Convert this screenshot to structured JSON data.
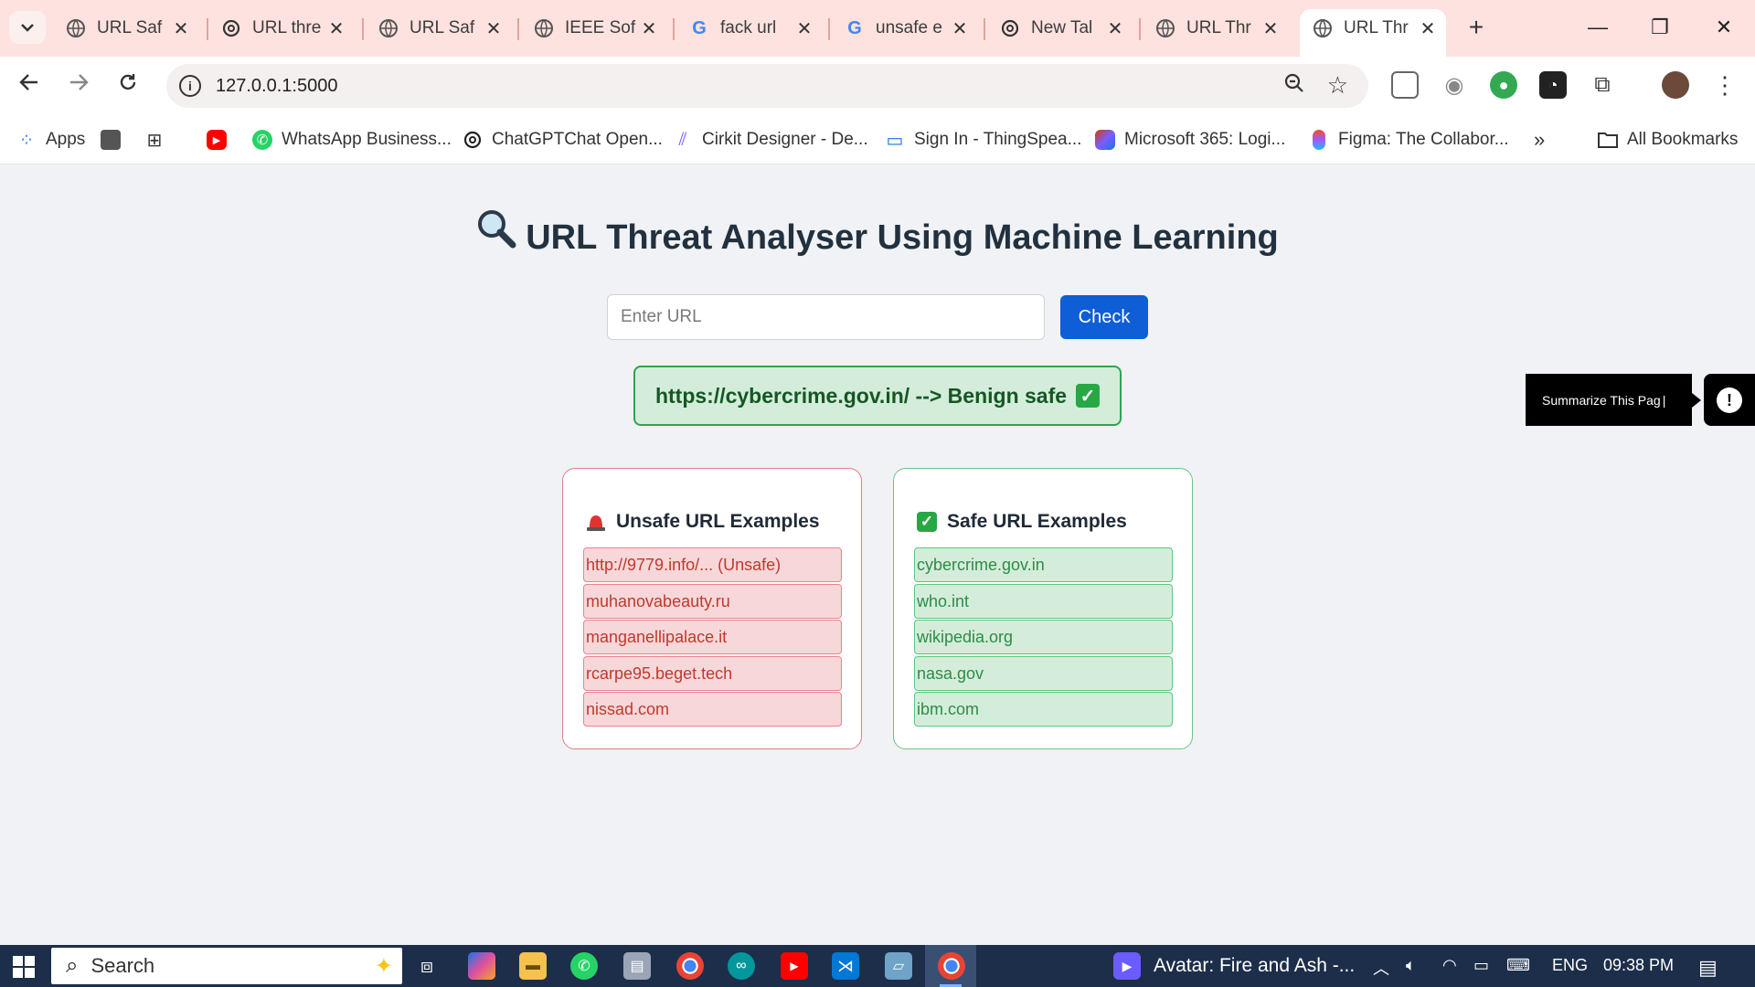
{
  "browser": {
    "tabs": [
      {
        "title": "URL Saf",
        "icon": "globe-icon",
        "active": false
      },
      {
        "title": "URL thre",
        "icon": "chatgpt-icon",
        "active": false
      },
      {
        "title": "URL Saf",
        "icon": "globe-icon",
        "active": false
      },
      {
        "title": "IEEE Sof",
        "icon": "globe-icon",
        "active": false
      },
      {
        "title": "fack url",
        "icon": "google-icon",
        "active": false
      },
      {
        "title": "unsafe e",
        "icon": "google-icon",
        "active": false
      },
      {
        "title": "New Tal",
        "icon": "chatgpt-icon",
        "active": false
      },
      {
        "title": "URL Thr",
        "icon": "globe-icon",
        "active": false
      },
      {
        "title": "URL Thr",
        "icon": "globe-icon",
        "active": true
      }
    ],
    "address": "127.0.0.1:5000",
    "bookmarks": [
      {
        "label": "Apps",
        "icon": "apps-grid-icon",
        "color": "#4285f4"
      },
      {
        "label": "",
        "icon": "square-icon",
        "color": "#555555"
      },
      {
        "label": "",
        "icon": "grid-icon",
        "color": "#333333"
      },
      {
        "label": "",
        "icon": "youtube-icon",
        "color": "#ff0000"
      },
      {
        "label": "WhatsApp Business...",
        "icon": "whatsapp-icon",
        "color": "#25d366"
      },
      {
        "label": "ChatGPTChat Open...",
        "icon": "chatgpt-icon",
        "color": "#222222"
      },
      {
        "label": "Cirkit Designer - De...",
        "icon": "cirkit-icon",
        "color": "#7b5cff"
      },
      {
        "label": "Sign In - ThingSpea...",
        "icon": "monitor-icon",
        "color": "#1a73e8"
      },
      {
        "label": "Microsoft 365: Logi...",
        "icon": "m365-icon",
        "color": "#d83b01"
      },
      {
        "label": "Figma: The Collabor...",
        "icon": "figma-icon",
        "color": "#f24e1e"
      }
    ],
    "all_bookmarks": "All Bookmarks"
  },
  "page": {
    "title": "URL Threat Analyser Using Machine Learning",
    "input_placeholder": "Enter URL",
    "check_label": "Check",
    "result_text": "https://cybercrime.gov.in/ --> Benign safe",
    "result_color": "#155724",
    "unsafe": {
      "heading": "Unsafe URL Examples",
      "items": [
        "http://9779.info/... (Unsafe)",
        "muhanovabeauty.ru",
        "manganellipalace.it",
        "rcarpe95.beget.tech",
        "nissad.com"
      ]
    },
    "safe": {
      "heading": "Safe URL Examples",
      "items": [
        "cybercrime.gov.in",
        "who.int",
        "wikipedia.org",
        "nasa.gov",
        "ibm.com"
      ]
    },
    "summarize_label": "Summarize This Pag"
  },
  "taskbar": {
    "search_label": "Search",
    "media_title": "Avatar: Fire and Ash -...",
    "language": "ENG",
    "time": "09:38 PM"
  }
}
